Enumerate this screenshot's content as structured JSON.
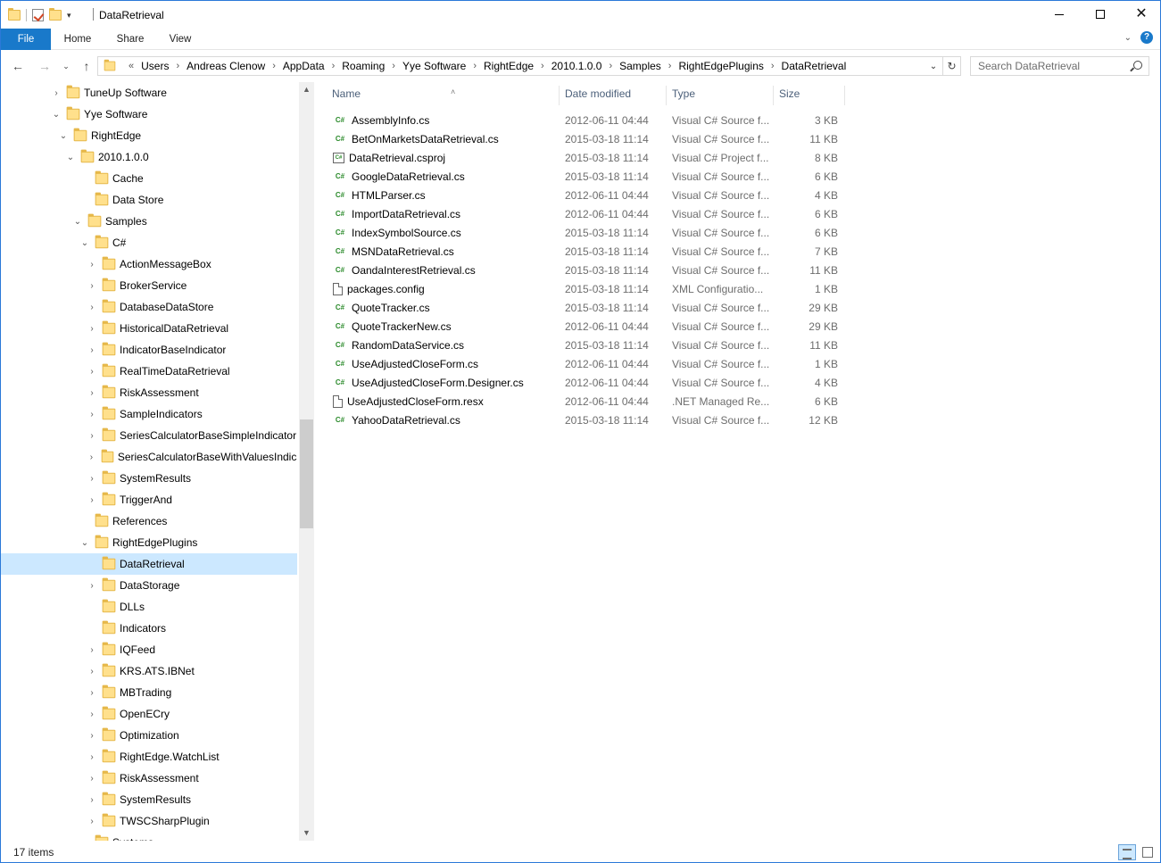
{
  "window": {
    "title": "DataRetrieval",
    "controls": {
      "minimize": "—",
      "maximize": "□",
      "close": "✕"
    }
  },
  "ribbon": {
    "tabs": [
      "File",
      "Home",
      "Share",
      "View"
    ],
    "expand_icon": "chevron-down-icon",
    "help_icon": "help-icon"
  },
  "address": {
    "breadcrumbs": [
      "Users",
      "Andreas Clenow",
      "AppData",
      "Roaming",
      "Yye Software",
      "RightEdge",
      "2010.1.0.0",
      "Samples",
      "RightEdgePlugins",
      "DataRetrieval"
    ]
  },
  "search": {
    "placeholder": "Search DataRetrieval"
  },
  "tree": {
    "items": [
      {
        "label": "TuneUp Software",
        "chevron": "›"
      },
      {
        "label": "Yye Software",
        "chevron": "⌄"
      },
      {
        "label": "RightEdge",
        "chevron": "⌄"
      },
      {
        "label": "2010.1.0.0",
        "chevron": "⌄"
      },
      {
        "label": "Cache",
        "chevron": ""
      },
      {
        "label": "Data Store",
        "chevron": ""
      },
      {
        "label": "Samples",
        "chevron": "⌄"
      },
      {
        "label": "C#",
        "chevron": "⌄"
      },
      {
        "label": "ActionMessageBox",
        "chevron": "›"
      },
      {
        "label": "BrokerService",
        "chevron": "›"
      },
      {
        "label": "DatabaseDataStore",
        "chevron": "›"
      },
      {
        "label": "HistoricalDataRetrieval",
        "chevron": "›"
      },
      {
        "label": "IndicatorBaseIndicator",
        "chevron": "›"
      },
      {
        "label": "RealTimeDataRetrieval",
        "chevron": "›"
      },
      {
        "label": "RiskAssessment",
        "chevron": "›"
      },
      {
        "label": "SampleIndicators",
        "chevron": "›"
      },
      {
        "label": "SeriesCalculatorBaseSimpleIndicator",
        "chevron": "›"
      },
      {
        "label": "SeriesCalculatorBaseWithValuesIndicator",
        "chevron": "›"
      },
      {
        "label": "SystemResults",
        "chevron": "›"
      },
      {
        "label": "TriggerAnd",
        "chevron": "›"
      },
      {
        "label": "References",
        "chevron": ""
      },
      {
        "label": "RightEdgePlugins",
        "chevron": "⌄"
      },
      {
        "label": "DataRetrieval",
        "chevron": ""
      },
      {
        "label": "DataStorage",
        "chevron": "›"
      },
      {
        "label": "DLLs",
        "chevron": ""
      },
      {
        "label": "Indicators",
        "chevron": ""
      },
      {
        "label": "IQFeed",
        "chevron": "›"
      },
      {
        "label": "KRS.ATS.IBNet",
        "chevron": "›"
      },
      {
        "label": "MBTrading",
        "chevron": "›"
      },
      {
        "label": "OpenECry",
        "chevron": "›"
      },
      {
        "label": "Optimization",
        "chevron": "›"
      },
      {
        "label": "RightEdge.WatchList",
        "chevron": "›"
      },
      {
        "label": "RiskAssessment",
        "chevron": "›"
      },
      {
        "label": "SystemResults",
        "chevron": "›"
      },
      {
        "label": "TWSCSharpPlugin",
        "chevron": "›"
      },
      {
        "label": "Systems",
        "chevron": "›"
      }
    ]
  },
  "columns": {
    "name": "Name",
    "date": "Date modified",
    "type": "Type",
    "size": "Size"
  },
  "files": [
    {
      "icon": "csharp-file-icon",
      "glyph": "C#",
      "name": "AssemblyInfo.cs",
      "date": "2012-06-11 04:44",
      "type": "Visual C# Source f...",
      "size": "3 KB"
    },
    {
      "icon": "csharp-file-icon",
      "glyph": "C#",
      "name": "BetOnMarketsDataRetrieval.cs",
      "date": "2015-03-18 11:14",
      "type": "Visual C# Source f...",
      "size": "11 KB"
    },
    {
      "icon": "csharp-project-icon",
      "glyph": "C#",
      "name": "DataRetrieval.csproj",
      "date": "2015-03-18 11:14",
      "type": "Visual C# Project f...",
      "size": "8 KB"
    },
    {
      "icon": "csharp-file-icon",
      "glyph": "C#",
      "name": "GoogleDataRetrieval.cs",
      "date": "2015-03-18 11:14",
      "type": "Visual C# Source f...",
      "size": "6 KB"
    },
    {
      "icon": "csharp-file-icon",
      "glyph": "C#",
      "name": "HTMLParser.cs",
      "date": "2012-06-11 04:44",
      "type": "Visual C# Source f...",
      "size": "4 KB"
    },
    {
      "icon": "csharp-file-icon",
      "glyph": "C#",
      "name": "ImportDataRetrieval.cs",
      "date": "2012-06-11 04:44",
      "type": "Visual C# Source f...",
      "size": "6 KB"
    },
    {
      "icon": "csharp-file-icon",
      "glyph": "C#",
      "name": "IndexSymbolSource.cs",
      "date": "2015-03-18 11:14",
      "type": "Visual C# Source f...",
      "size": "6 KB"
    },
    {
      "icon": "csharp-file-icon",
      "glyph": "C#",
      "name": "MSNDataRetrieval.cs",
      "date": "2015-03-18 11:14",
      "type": "Visual C# Source f...",
      "size": "7 KB"
    },
    {
      "icon": "csharp-file-icon",
      "glyph": "C#",
      "name": "OandaInterestRetrieval.cs",
      "date": "2015-03-18 11:14",
      "type": "Visual C# Source f...",
      "size": "11 KB"
    },
    {
      "icon": "config-file-icon",
      "glyph": "",
      "name": "packages.config",
      "date": "2015-03-18 11:14",
      "type": "XML Configuratio...",
      "size": "1 KB"
    },
    {
      "icon": "csharp-file-icon",
      "glyph": "C#",
      "name": "QuoteTracker.cs",
      "date": "2015-03-18 11:14",
      "type": "Visual C# Source f...",
      "size": "29 KB"
    },
    {
      "icon": "csharp-file-icon",
      "glyph": "C#",
      "name": "QuoteTrackerNew.cs",
      "date": "2012-06-11 04:44",
      "type": "Visual C# Source f...",
      "size": "29 KB"
    },
    {
      "icon": "csharp-file-icon",
      "glyph": "C#",
      "name": "RandomDataService.cs",
      "date": "2015-03-18 11:14",
      "type": "Visual C# Source f...",
      "size": "11 KB"
    },
    {
      "icon": "csharp-file-icon",
      "glyph": "C#",
      "name": "UseAdjustedCloseForm.cs",
      "date": "2012-06-11 04:44",
      "type": "Visual C# Source f...",
      "size": "1 KB"
    },
    {
      "icon": "csharp-file-icon",
      "glyph": "C#",
      "name": "UseAdjustedCloseForm.Designer.cs",
      "date": "2012-06-11 04:44",
      "type": "Visual C# Source f...",
      "size": "4 KB"
    },
    {
      "icon": "resx-file-icon",
      "glyph": "",
      "name": "UseAdjustedCloseForm.resx",
      "date": "2012-06-11 04:44",
      "type": ".NET Managed Re...",
      "size": "6 KB"
    },
    {
      "icon": "csharp-file-icon",
      "glyph": "C#",
      "name": "YahooDataRetrieval.cs",
      "date": "2015-03-18 11:14",
      "type": "Visual C# Source f...",
      "size": "12 KB"
    }
  ],
  "status": {
    "item_count": "17 items"
  },
  "colors": {
    "accent": "#1979ca",
    "selection": "#cce8ff",
    "folder": "#ffe08c",
    "csharp": "#2c8b2c"
  }
}
